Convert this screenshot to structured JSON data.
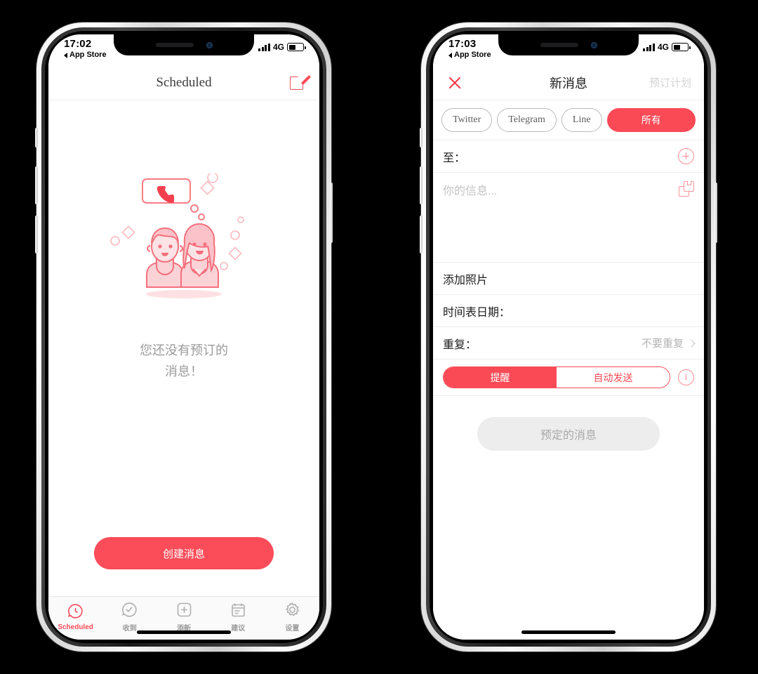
{
  "phone_left": {
    "status_bar": {
      "time": "17:02",
      "back_label": "App Store",
      "network": "4G"
    },
    "navbar": {
      "title": "Scheduled",
      "compose_icon": "compose-icon"
    },
    "empty_state": {
      "illustration": "two-people-with-phone-message-illustration",
      "text_line1": "您还没有预订的",
      "text_line2": "消息！"
    },
    "cta": {
      "label": "创建消息"
    },
    "tabs": [
      {
        "label": "Scheduled",
        "icon": "clock-bubble-icon",
        "active": true
      },
      {
        "label": "收到",
        "icon": "check-bubble-icon",
        "active": false
      },
      {
        "label": "添新",
        "icon": "plus-square-icon",
        "active": false
      },
      {
        "label": "建议",
        "icon": "calendar-icon",
        "active": false
      },
      {
        "label": "设置",
        "icon": "gear-icon",
        "active": false
      }
    ]
  },
  "phone_right": {
    "status_bar": {
      "time": "17:03",
      "back_label": "App Store",
      "network": "4G"
    },
    "navbar": {
      "close_icon": "close-icon",
      "title": "新消息",
      "action_label": "预订计划"
    },
    "chips": [
      {
        "label": "Twitter",
        "active": false
      },
      {
        "label": "Telegram",
        "active": false
      },
      {
        "label": "Line",
        "active": false
      },
      {
        "label": "所有",
        "active": true
      }
    ],
    "to_row": {
      "label": "至：",
      "add_icon": "plus-circle-icon"
    },
    "message": {
      "placeholder": "你的信息...",
      "value": "",
      "save_icon": "save-template-icon"
    },
    "photo_row": {
      "label": "添加照片"
    },
    "date_row": {
      "label": "时间表日期：",
      "value": ""
    },
    "repeat_row": {
      "label": "重复：",
      "value": "不要重复",
      "chevron": "chevron-right-icon"
    },
    "segmented": {
      "option_on": "提醒",
      "option_off": "自动发送",
      "info_icon": "info-icon"
    },
    "submit": {
      "label": "预定的消息",
      "disabled": true
    }
  },
  "theme": {
    "accent": "#fa4c59",
    "accent_light": "#f98d95",
    "muted": "#9b9b9b",
    "disabled_bg": "#ededed"
  }
}
